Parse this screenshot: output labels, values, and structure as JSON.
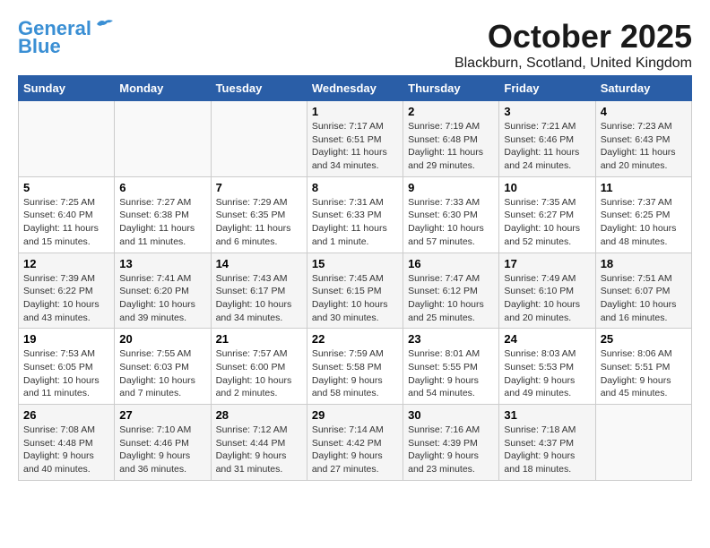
{
  "logo": {
    "line1": "General",
    "line2": "Blue"
  },
  "title": "October 2025",
  "subtitle": "Blackburn, Scotland, United Kingdom",
  "weekdays": [
    "Sunday",
    "Monday",
    "Tuesday",
    "Wednesday",
    "Thursday",
    "Friday",
    "Saturday"
  ],
  "weeks": [
    [
      {
        "day": "",
        "info": ""
      },
      {
        "day": "",
        "info": ""
      },
      {
        "day": "",
        "info": ""
      },
      {
        "day": "1",
        "info": "Sunrise: 7:17 AM\nSunset: 6:51 PM\nDaylight: 11 hours\nand 34 minutes."
      },
      {
        "day": "2",
        "info": "Sunrise: 7:19 AM\nSunset: 6:48 PM\nDaylight: 11 hours\nand 29 minutes."
      },
      {
        "day": "3",
        "info": "Sunrise: 7:21 AM\nSunset: 6:46 PM\nDaylight: 11 hours\nand 24 minutes."
      },
      {
        "day": "4",
        "info": "Sunrise: 7:23 AM\nSunset: 6:43 PM\nDaylight: 11 hours\nand 20 minutes."
      }
    ],
    [
      {
        "day": "5",
        "info": "Sunrise: 7:25 AM\nSunset: 6:40 PM\nDaylight: 11 hours\nand 15 minutes."
      },
      {
        "day": "6",
        "info": "Sunrise: 7:27 AM\nSunset: 6:38 PM\nDaylight: 11 hours\nand 11 minutes."
      },
      {
        "day": "7",
        "info": "Sunrise: 7:29 AM\nSunset: 6:35 PM\nDaylight: 11 hours\nand 6 minutes."
      },
      {
        "day": "8",
        "info": "Sunrise: 7:31 AM\nSunset: 6:33 PM\nDaylight: 11 hours\nand 1 minute."
      },
      {
        "day": "9",
        "info": "Sunrise: 7:33 AM\nSunset: 6:30 PM\nDaylight: 10 hours\nand 57 minutes."
      },
      {
        "day": "10",
        "info": "Sunrise: 7:35 AM\nSunset: 6:27 PM\nDaylight: 10 hours\nand 52 minutes."
      },
      {
        "day": "11",
        "info": "Sunrise: 7:37 AM\nSunset: 6:25 PM\nDaylight: 10 hours\nand 48 minutes."
      }
    ],
    [
      {
        "day": "12",
        "info": "Sunrise: 7:39 AM\nSunset: 6:22 PM\nDaylight: 10 hours\nand 43 minutes."
      },
      {
        "day": "13",
        "info": "Sunrise: 7:41 AM\nSunset: 6:20 PM\nDaylight: 10 hours\nand 39 minutes."
      },
      {
        "day": "14",
        "info": "Sunrise: 7:43 AM\nSunset: 6:17 PM\nDaylight: 10 hours\nand 34 minutes."
      },
      {
        "day": "15",
        "info": "Sunrise: 7:45 AM\nSunset: 6:15 PM\nDaylight: 10 hours\nand 30 minutes."
      },
      {
        "day": "16",
        "info": "Sunrise: 7:47 AM\nSunset: 6:12 PM\nDaylight: 10 hours\nand 25 minutes."
      },
      {
        "day": "17",
        "info": "Sunrise: 7:49 AM\nSunset: 6:10 PM\nDaylight: 10 hours\nand 20 minutes."
      },
      {
        "day": "18",
        "info": "Sunrise: 7:51 AM\nSunset: 6:07 PM\nDaylight: 10 hours\nand 16 minutes."
      }
    ],
    [
      {
        "day": "19",
        "info": "Sunrise: 7:53 AM\nSunset: 6:05 PM\nDaylight: 10 hours\nand 11 minutes."
      },
      {
        "day": "20",
        "info": "Sunrise: 7:55 AM\nSunset: 6:03 PM\nDaylight: 10 hours\nand 7 minutes."
      },
      {
        "day": "21",
        "info": "Sunrise: 7:57 AM\nSunset: 6:00 PM\nDaylight: 10 hours\nand 2 minutes."
      },
      {
        "day": "22",
        "info": "Sunrise: 7:59 AM\nSunset: 5:58 PM\nDaylight: 9 hours\nand 58 minutes."
      },
      {
        "day": "23",
        "info": "Sunrise: 8:01 AM\nSunset: 5:55 PM\nDaylight: 9 hours\nand 54 minutes."
      },
      {
        "day": "24",
        "info": "Sunrise: 8:03 AM\nSunset: 5:53 PM\nDaylight: 9 hours\nand 49 minutes."
      },
      {
        "day": "25",
        "info": "Sunrise: 8:06 AM\nSunset: 5:51 PM\nDaylight: 9 hours\nand 45 minutes."
      }
    ],
    [
      {
        "day": "26",
        "info": "Sunrise: 7:08 AM\nSunset: 4:48 PM\nDaylight: 9 hours\nand 40 minutes."
      },
      {
        "day": "27",
        "info": "Sunrise: 7:10 AM\nSunset: 4:46 PM\nDaylight: 9 hours\nand 36 minutes."
      },
      {
        "day": "28",
        "info": "Sunrise: 7:12 AM\nSunset: 4:44 PM\nDaylight: 9 hours\nand 31 minutes."
      },
      {
        "day": "29",
        "info": "Sunrise: 7:14 AM\nSunset: 4:42 PM\nDaylight: 9 hours\nand 27 minutes."
      },
      {
        "day": "30",
        "info": "Sunrise: 7:16 AM\nSunset: 4:39 PM\nDaylight: 9 hours\nand 23 minutes."
      },
      {
        "day": "31",
        "info": "Sunrise: 7:18 AM\nSunset: 4:37 PM\nDaylight: 9 hours\nand 18 minutes."
      },
      {
        "day": "",
        "info": ""
      }
    ]
  ]
}
